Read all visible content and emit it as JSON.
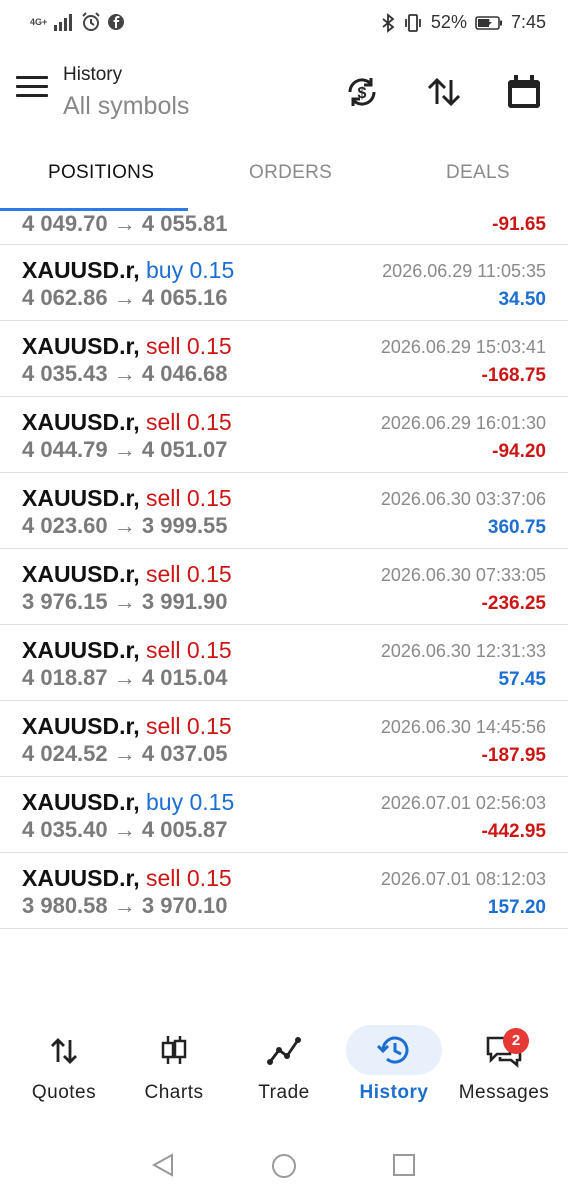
{
  "status_bar": {
    "network": "4G+",
    "battery": "52%",
    "time": "7:45"
  },
  "header": {
    "title": "History",
    "subtitle": "All symbols"
  },
  "tabs": [
    {
      "label": "POSITIONS"
    },
    {
      "label": "ORDERS"
    },
    {
      "label": "DEALS"
    }
  ],
  "rows": [
    {
      "symbol": "",
      "side": "",
      "volume": "",
      "date": "",
      "open": "4 049.70",
      "close": "4 055.81",
      "profit": "-91.65"
    },
    {
      "symbol": "XAUUSD.r,",
      "side": "buy",
      "volume": "0.15",
      "date": "2026.06.29 11:05:35",
      "open": "4 062.86",
      "close": "4 065.16",
      "profit": "34.50"
    },
    {
      "symbol": "XAUUSD.r,",
      "side": "sell",
      "volume": "0.15",
      "date": "2026.06.29 15:03:41",
      "open": "4 035.43",
      "close": "4 046.68",
      "profit": "-168.75"
    },
    {
      "symbol": "XAUUSD.r,",
      "side": "sell",
      "volume": "0.15",
      "date": "2026.06.29 16:01:30",
      "open": "4 044.79",
      "close": "4 051.07",
      "profit": "-94.20"
    },
    {
      "symbol": "XAUUSD.r,",
      "side": "sell",
      "volume": "0.15",
      "date": "2026.06.30 03:37:06",
      "open": "4 023.60",
      "close": "3 999.55",
      "profit": "360.75"
    },
    {
      "symbol": "XAUUSD.r,",
      "side": "sell",
      "volume": "0.15",
      "date": "2026.06.30 07:33:05",
      "open": "3 976.15",
      "close": "3 991.90",
      "profit": "-236.25"
    },
    {
      "symbol": "XAUUSD.r,",
      "side": "sell",
      "volume": "0.15",
      "date": "2026.06.30 12:31:33",
      "open": "4 018.87",
      "close": "4 015.04",
      "profit": "57.45"
    },
    {
      "symbol": "XAUUSD.r,",
      "side": "sell",
      "volume": "0.15",
      "date": "2026.06.30 14:45:56",
      "open": "4 024.52",
      "close": "4 037.05",
      "profit": "-187.95"
    },
    {
      "symbol": "XAUUSD.r,",
      "side": "buy",
      "volume": "0.15",
      "date": "2026.07.01 02:56:03",
      "open": "4 035.40",
      "close": "4 005.87",
      "profit": "-442.95"
    },
    {
      "symbol": "XAUUSD.r,",
      "side": "sell",
      "volume": "0.15",
      "date": "2026.07.01 08:12:03",
      "open": "3 980.58",
      "close": "3 970.10",
      "profit": "157.20"
    }
  ],
  "arrow": "→",
  "bottom_nav": [
    {
      "label": "Quotes",
      "icon": "quotes-arrows-icon"
    },
    {
      "label": "Charts",
      "icon": "candlestick-icon"
    },
    {
      "label": "Trade",
      "icon": "trade-line-icon"
    },
    {
      "label": "History",
      "icon": "history-clock-icon"
    },
    {
      "label": "Messages",
      "icon": "messages-icon"
    }
  ],
  "messages_badge": "2",
  "colors": {
    "accent": "#1c6fd0",
    "loss": "#cc1616",
    "tab_indicator": "#2d7be5"
  }
}
